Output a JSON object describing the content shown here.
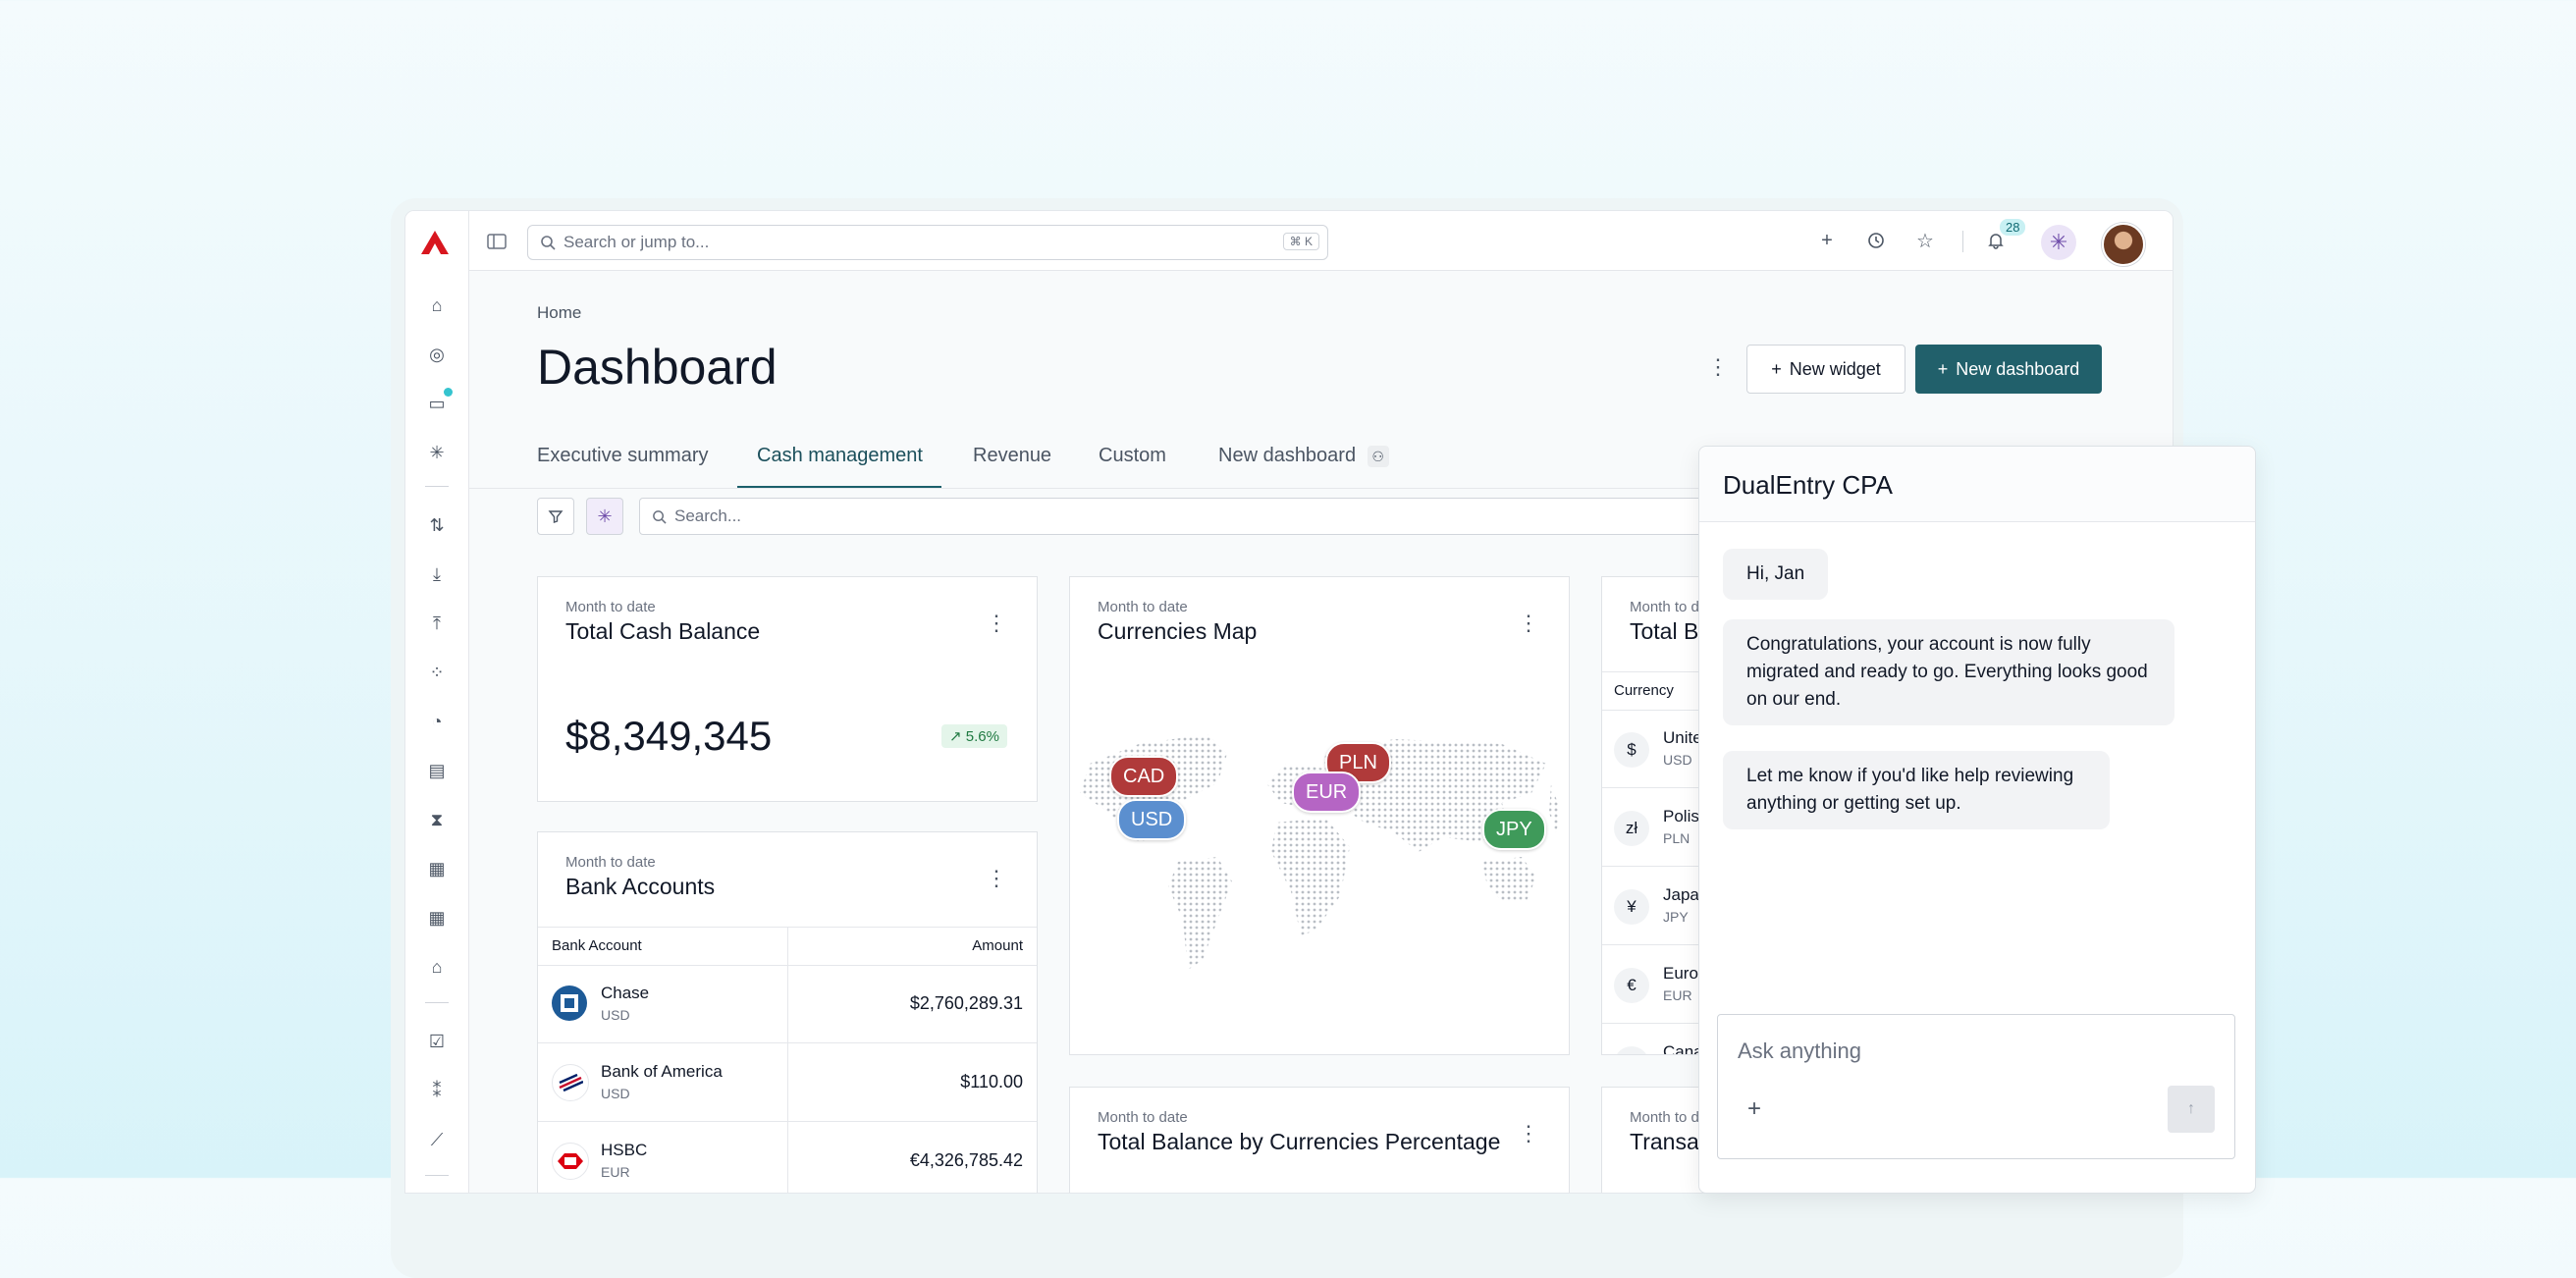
{
  "search": {
    "placeholder": "Search or jump to...",
    "shortcut": "⌘ K"
  },
  "topbar": {
    "notifications_count": "28"
  },
  "page": {
    "breadcrumb": "Home",
    "title": "Dashboard"
  },
  "actions": {
    "new_widget": "New widget",
    "new_dashboard": "New dashboard"
  },
  "tabs": [
    {
      "label": "Executive summary"
    },
    {
      "label": "Cash management"
    },
    {
      "label": "Revenue"
    },
    {
      "label": "Custom"
    },
    {
      "label": "New dashboard"
    }
  ],
  "filters": {
    "search_placeholder": "Search..."
  },
  "cards": {
    "total_cash": {
      "subtitle": "Month to date",
      "title": "Total Cash Balance",
      "value": "$8,349,345",
      "change": "5.6%"
    },
    "bank_accounts": {
      "subtitle": "Month to date",
      "title": "Bank Accounts",
      "columns": [
        "Bank Account",
        "Amount"
      ],
      "rows": [
        {
          "name": "Chase",
          "currency": "USD",
          "amount": "$2,760,289.31"
        },
        {
          "name": "Bank of America",
          "currency": "USD",
          "amount": "$110.00"
        },
        {
          "name": "HSBC",
          "currency": "EUR",
          "amount": "€4,326,785.42"
        }
      ]
    },
    "currencies_map": {
      "subtitle": "Month to date",
      "title": "Currencies Map",
      "pins": [
        "CAD",
        "USD",
        "PLN",
        "EUR",
        "JPY"
      ]
    },
    "total_balance_pct": {
      "subtitle": "Month to date",
      "title": "Total Balance by Currencies Percentage"
    },
    "total_balance": {
      "subtitle": "Month to d",
      "title": "Total Ba",
      "column": "Currency",
      "rows": [
        {
          "symbol": "$",
          "name": "Unite",
          "code": "USD"
        },
        {
          "symbol": "zł",
          "name": "Polis",
          "code": "PLN"
        },
        {
          "symbol": "¥",
          "name": "Japa",
          "code": "JPY"
        },
        {
          "symbol": "€",
          "name": "Euro",
          "code": "EUR"
        },
        {
          "symbol": "",
          "name": "Cana",
          "code": ""
        }
      ]
    },
    "transactions": {
      "subtitle": "Month to d",
      "title": "Transa"
    }
  },
  "chat": {
    "title": "DualEntry CPA",
    "messages": [
      "Hi, Jan",
      "Congratulations, your account is now fully migrated and ready to go. Everything looks good on our end.",
      "Let me know if you'd like help reviewing anything or getting set up."
    ],
    "placeholder": "Ask anything"
  },
  "colors": {
    "primary": "#21606b",
    "pin_cad": "#b03a3a",
    "pin_usd": "#5b8fcf",
    "pin_pln": "#b03a3a",
    "pin_eur": "#b565c4",
    "pin_jpy": "#3f9a5a"
  }
}
